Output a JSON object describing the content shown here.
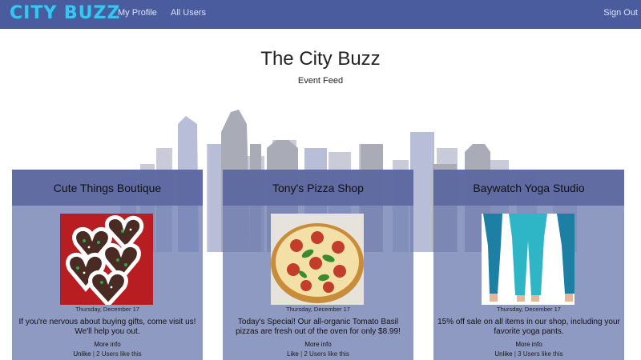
{
  "nav": {
    "brand": "CITY BUZZ",
    "links": [
      "My Profile",
      "All Users"
    ],
    "sign_out": "Sign Out"
  },
  "header": {
    "title": "The City Buzz",
    "subtitle": "Event Feed"
  },
  "cards": [
    {
      "title": "Cute Things Boutique",
      "date": "Thursday, December 17",
      "description": "If you're nervous about buying gifts, come visit us! We'll help you out.",
      "more": "More info",
      "like_action": "Unlike",
      "likes_text": "2 Users like this"
    },
    {
      "title": "Tony's Pizza Shop",
      "date": "Thursday, December 17",
      "description": "Today's Special! Our all-organic Tomato Basil pizzas are fresh out of the oven for only $8.99!",
      "more": "More info",
      "like_action": "Like",
      "likes_text": "2 Users like this"
    },
    {
      "title": "Baywatch Yoga Studio",
      "date": "Thursday, December 17",
      "description": "15% off sale on all items in our shop, including your favorite yoga pants.",
      "more": "More info",
      "like_action": "Unlike",
      "likes_text": "3 Users like this"
    }
  ],
  "colors": {
    "navbar": "#4a5c9d",
    "brand": "#3bc4ef",
    "card_body": "#707db2",
    "card_header": "#5c68a0"
  }
}
